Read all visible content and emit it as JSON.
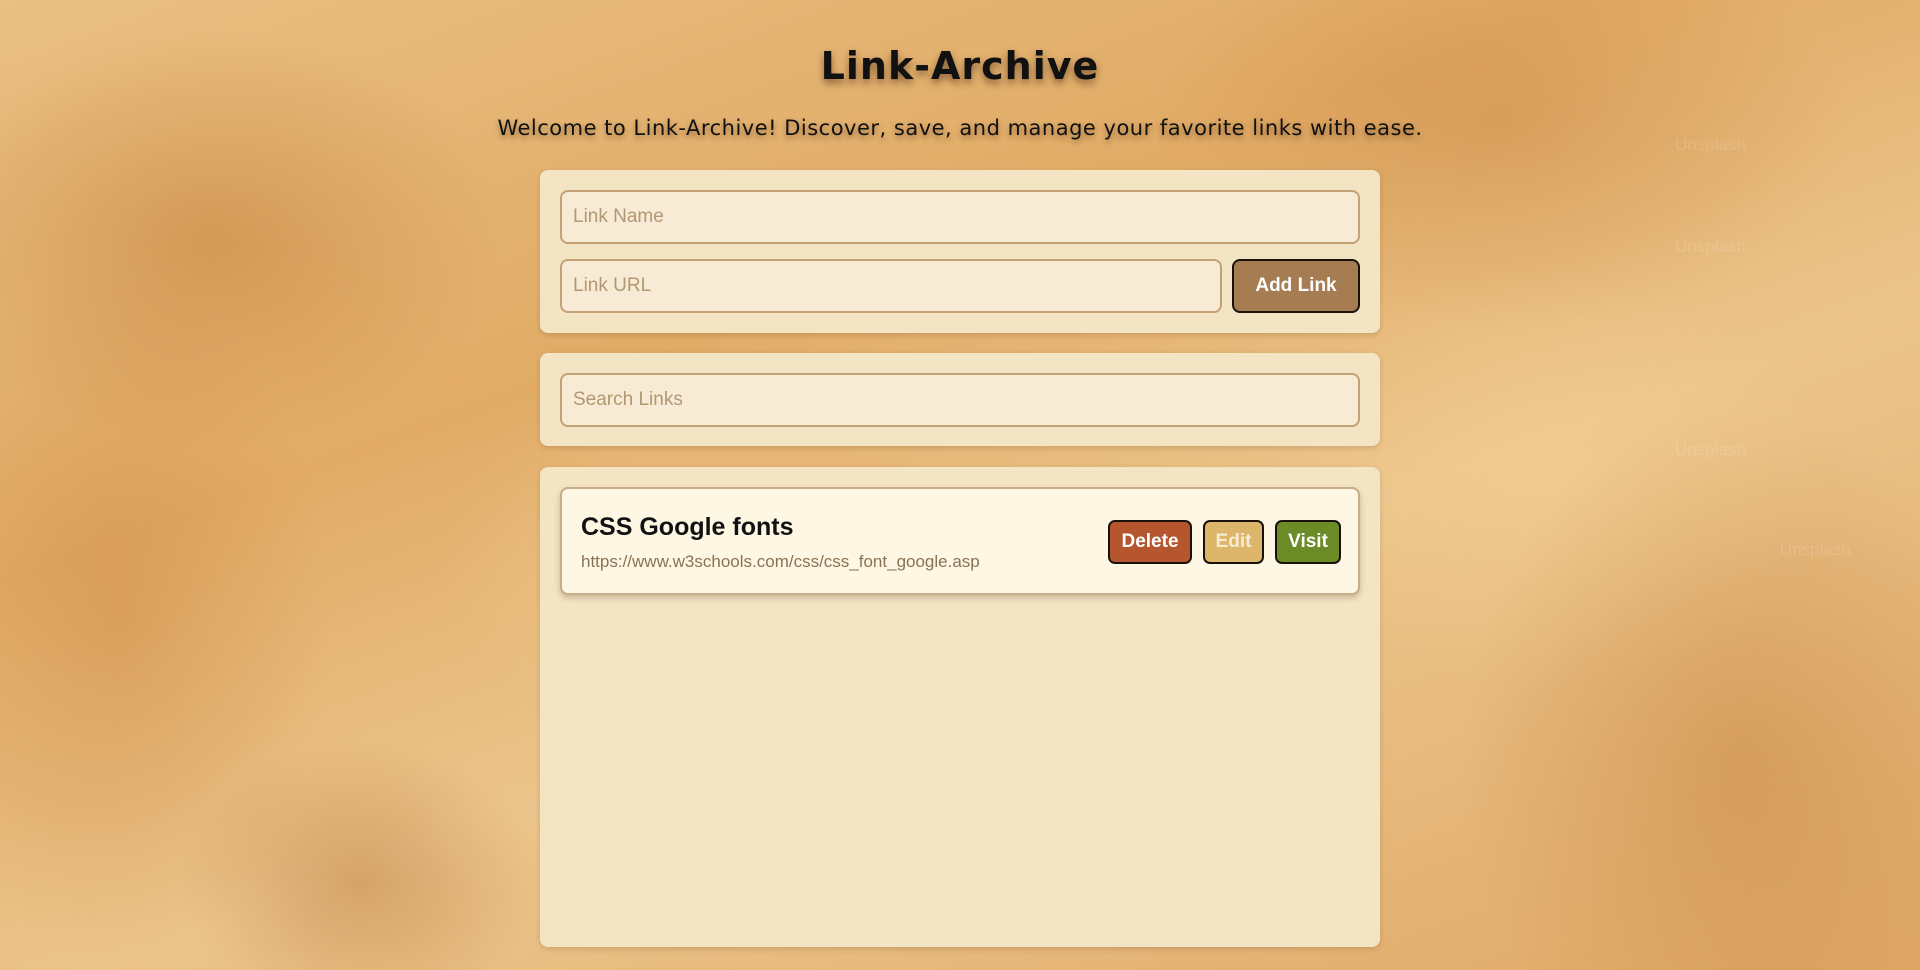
{
  "app": {
    "title": "Link-Archive",
    "subtitle": "Welcome to Link-Archive! Discover, save, and manage your favorite links with ease."
  },
  "form": {
    "name_placeholder": "Link Name",
    "url_placeholder": "Link URL",
    "add_label": "Add Link"
  },
  "search": {
    "placeholder": "Search Links"
  },
  "links": [
    {
      "name": "CSS Google fonts",
      "url": "https://www.w3schools.com/css/css_font_google.asp",
      "delete_label": "Delete",
      "edit_label": "Edit",
      "visit_label": "Visit"
    }
  ],
  "background": {
    "watermark_text": "Unsplash"
  },
  "colors": {
    "panel": "#f3e4c3",
    "add_button": "#a67c52",
    "delete_button": "#b5562f",
    "edit_button": "#ddb66b",
    "visit_button": "#6a8b25"
  }
}
